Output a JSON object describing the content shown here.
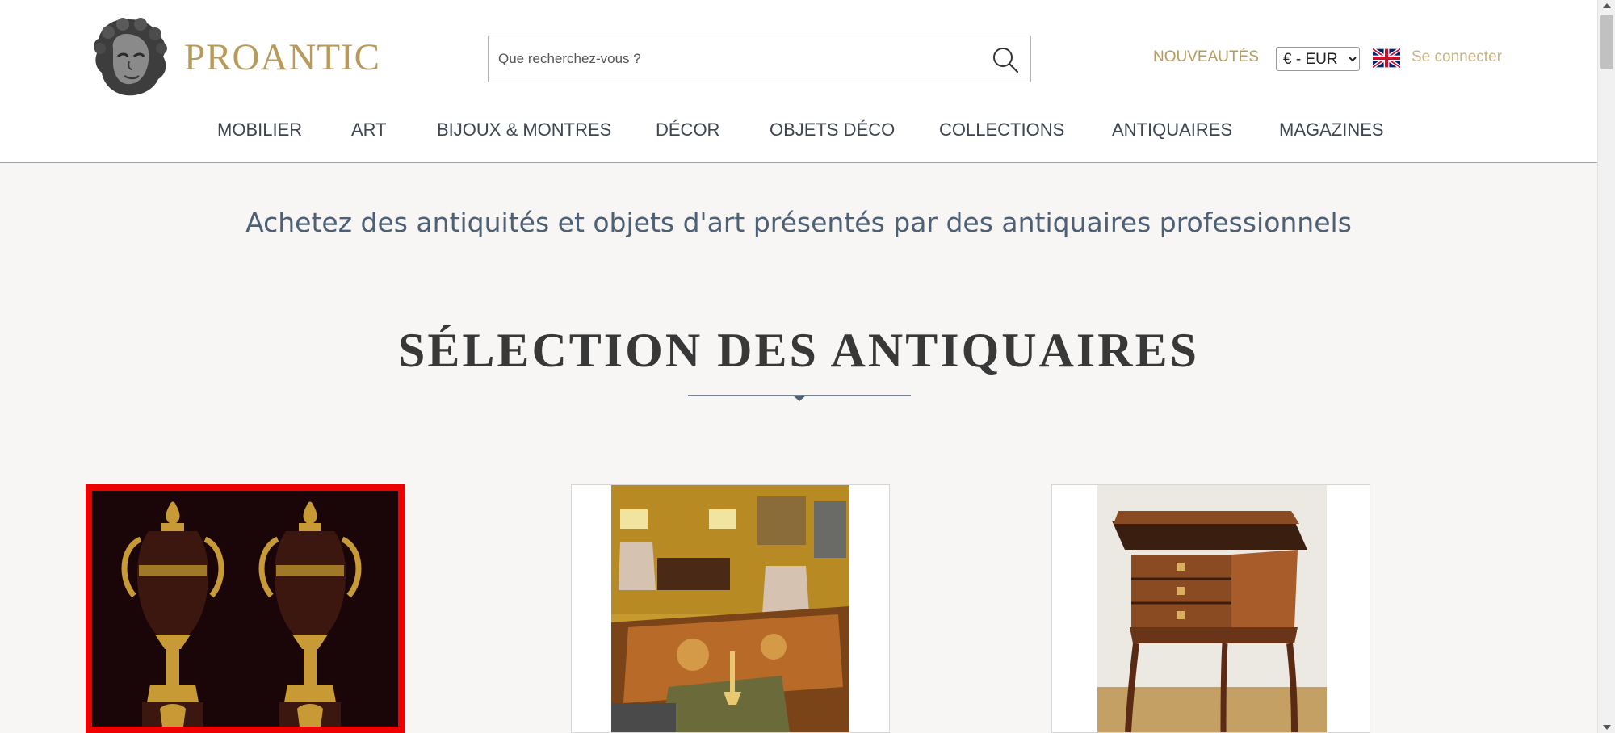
{
  "header": {
    "brand": "PROANTIC",
    "search_placeholder": "Que recherchez-vous ?",
    "nouveautes": "NOUVEAUTÉS",
    "currency": "€ - EUR",
    "currency_options": [
      "€ - EUR"
    ],
    "language_icon": "uk-flag-icon",
    "login": "Se connecter"
  },
  "nav": [
    {
      "label": "MOBILIER"
    },
    {
      "label": "ART"
    },
    {
      "label": "BIJOUX & MONTRES"
    },
    {
      "label": "DÉCOR"
    },
    {
      "label": "OBJETS DÉCO"
    },
    {
      "label": "COLLECTIONS"
    },
    {
      "label": "ANTIQUAIRES"
    },
    {
      "label": "MAGAZINES"
    }
  ],
  "main": {
    "tagline": "Achetez des antiquités et objets d'art présentés par des antiquaires professionnels",
    "section_title": "SÉLECTION DES ANTIQUAIRES"
  },
  "colors": {
    "brand_gold": "#b89a5c",
    "login_gold": "#c9b387",
    "nav_text": "#3e4652",
    "tagline_blue": "#4d6076",
    "selection_outline": "#ee0000",
    "page_background": "#f7f6f4"
  }
}
